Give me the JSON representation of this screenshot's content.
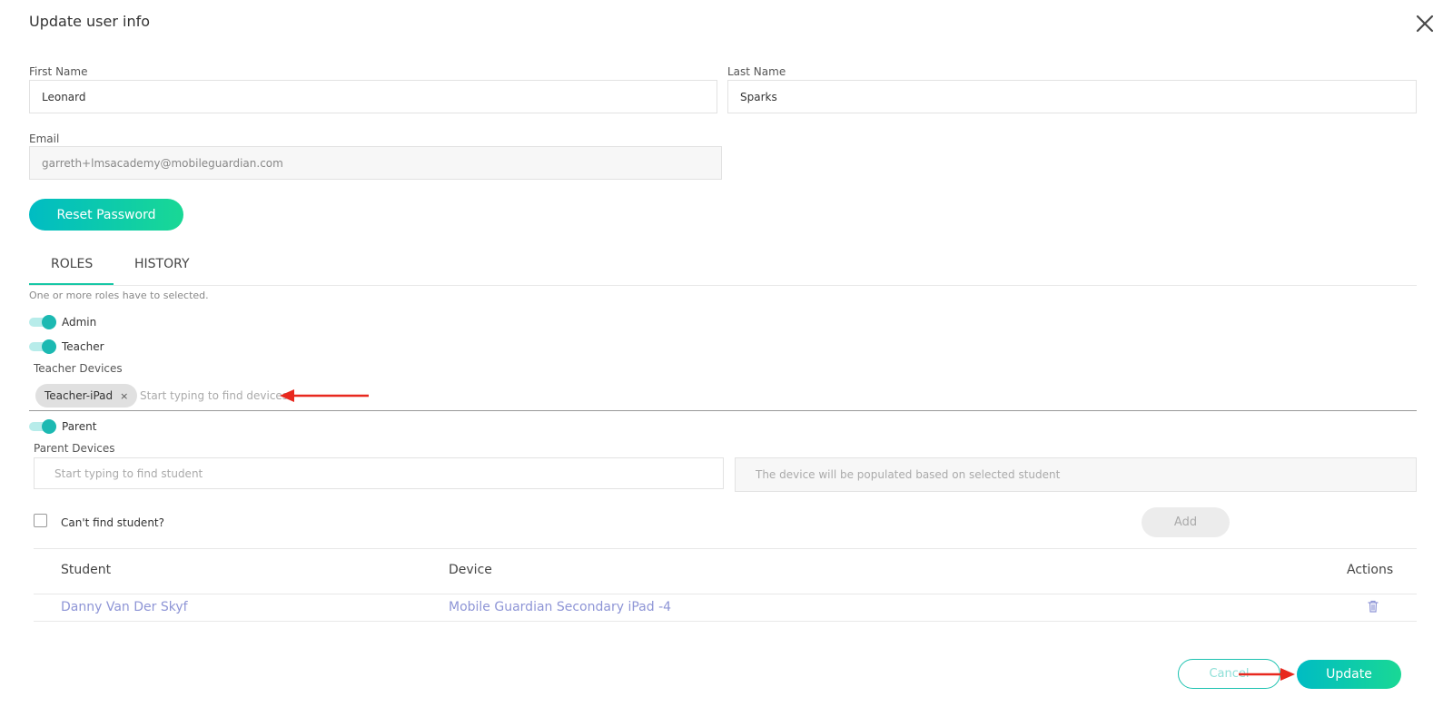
{
  "dialog": {
    "title": "Update user info",
    "close_icon": "close-icon"
  },
  "form": {
    "first_name": {
      "label": "First Name",
      "value": "Leonard"
    },
    "last_name": {
      "label": "Last Name",
      "value": "Sparks"
    },
    "email": {
      "label": "Email",
      "value": "garreth+lmsacademy@mobileguardian.com"
    },
    "reset_password_label": "Reset Password"
  },
  "tabs": [
    {
      "label": "ROLES",
      "active": true
    },
    {
      "label": "HISTORY",
      "active": false
    }
  ],
  "roles": {
    "hint": "One or more roles have to selected.",
    "admin": {
      "label": "Admin",
      "enabled": true
    },
    "teacher": {
      "label": "Teacher",
      "enabled": true
    },
    "teacher_devices": {
      "label": "Teacher Devices",
      "chips": [
        "Teacher-iPad"
      ],
      "chip_remove": "×",
      "placeholder": "Start typing to find devices"
    },
    "parent": {
      "label": "Parent",
      "enabled": true
    },
    "parent_devices": {
      "label": "Parent Devices",
      "student_placeholder": "Start typing to find student",
      "device_placeholder": "The device will be populated based on selected student"
    },
    "cant_find_label": "Can't find student?",
    "add_label": "Add"
  },
  "table": {
    "headers": [
      "Student",
      "Device",
      "Actions"
    ],
    "rows": [
      {
        "student": "Danny Van Der Skyf",
        "device": "Mobile Guardian Secondary iPad -4",
        "action_icon": "trash-icon"
      }
    ]
  },
  "footer": {
    "cancel_label": "Cancel",
    "update_label": "Update"
  },
  "colors": {
    "accent_start": "#00bcc3",
    "accent_end": "#19d895",
    "link": "#8e95d6",
    "annotation_arrow": "#e8281e"
  }
}
